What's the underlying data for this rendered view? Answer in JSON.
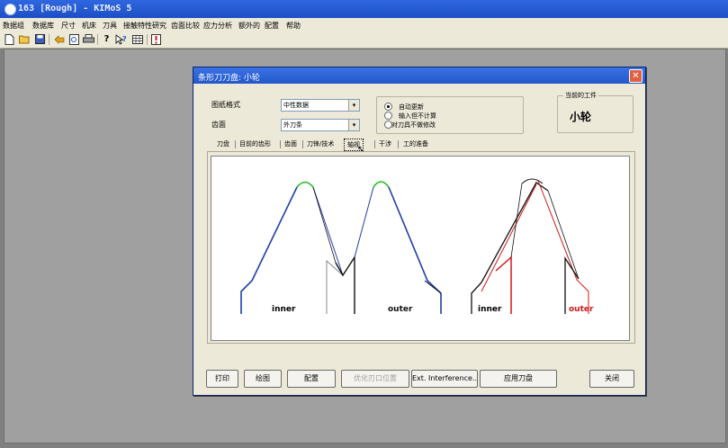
{
  "window": {
    "title": "163 [Rough] - KIMoS 5"
  },
  "menu": [
    "数据组",
    "数据库",
    "尺寸",
    "机床",
    "刀具",
    "接触特性研究",
    "齿面比较",
    "应力分析",
    "额外的",
    "配置",
    "帮助"
  ],
  "dialog": {
    "title": "条形刀刀盘: 小轮",
    "close_glyph": "✕",
    "format_label": "图纸格式",
    "format_value": "中性数据",
    "flank_label": "齿面",
    "flank_value": "外刀条",
    "radio": [
      "自动更新",
      "输入但不计算",
      "对刀具不做修改"
    ],
    "workpiece_group": "当前的工件",
    "workpiece_value": "小轮",
    "tabs": [
      "刀盘",
      "目前的齿形",
      "齿面",
      "刀锋/技术",
      "轴视",
      "干涉",
      "工的准备"
    ],
    "selected_tab": "轴视",
    "buttons": {
      "print": "打印",
      "draw": "绘图",
      "config": "配置",
      "optimize": "优化刃口位置",
      "interference": "Ext. Interference..",
      "apply": "应用刀盘",
      "close": "关闭"
    }
  },
  "drawing": {
    "labels": [
      "inner",
      "outer",
      "inner",
      "outer"
    ]
  },
  "colors": {
    "blue": "#1f3fa8",
    "green": "#22c022",
    "red": "#d01818",
    "dark": "#111111"
  }
}
